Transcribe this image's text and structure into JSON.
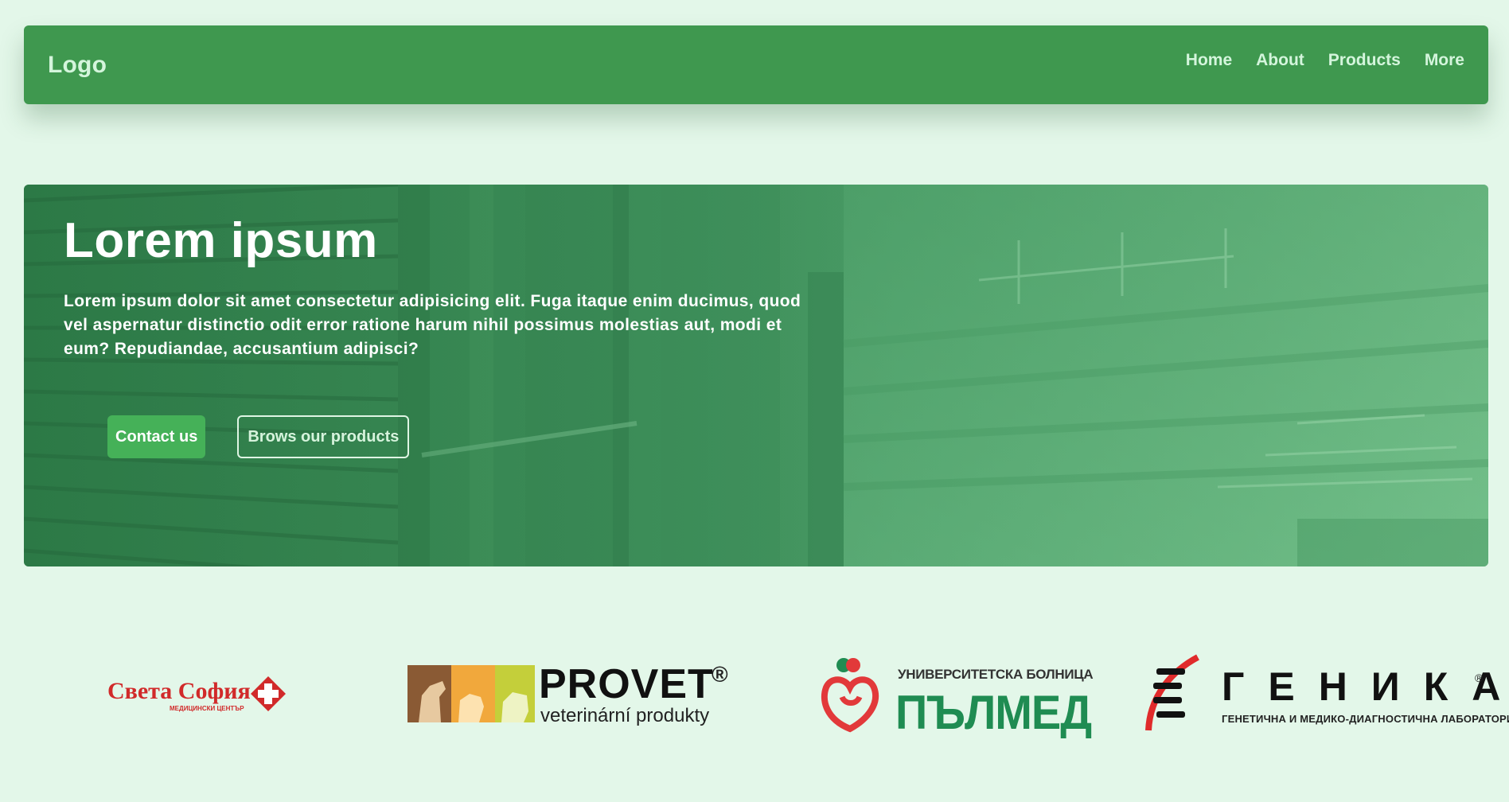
{
  "colors": {
    "page_background": "#e3f7e9",
    "navbar_background": "#3f984f",
    "nav_text": "#d4f5dc",
    "primary_button": "#45b158",
    "hero_text": "#ffffff"
  },
  "navbar": {
    "logo": "Logo",
    "links": [
      {
        "label": "Home"
      },
      {
        "label": "About"
      },
      {
        "label": "Products"
      },
      {
        "label": "More"
      }
    ]
  },
  "hero": {
    "title": "Lorem ipsum",
    "text": "Lorem ipsum dolor sit amet consectetur adipisicing elit. Fuga itaque enim ducimus, quod vel aspernatur distinctio odit error ratione harum nihil possimus molestias aut, modi et eum? Repudiandae, accusantium adipisci?",
    "primary_button": "Contact us",
    "secondary_button": "Brows our products"
  },
  "partners": [
    {
      "name": "Света София",
      "subtitle": "МЕДИЦИНСКИ ЦЕНТЪР",
      "icon": "red-cross-icon"
    },
    {
      "name": "PROVET",
      "subtitle": "veterinární produkty",
      "mark": "®",
      "icon": "animals-icon"
    },
    {
      "name": "ПЪЛМЕД",
      "subtitle": "УНИВЕРСИТЕТСКА БОЛНИЦА",
      "icon": "heart-icon"
    },
    {
      "name": "ГЕНИКА",
      "subtitle": "ГЕНЕТИЧНА И МЕДИКО-ДИАГНОСТИЧНА ЛАБОРАТОРИЯ",
      "mark": "®",
      "icon": "dna-icon"
    }
  ]
}
